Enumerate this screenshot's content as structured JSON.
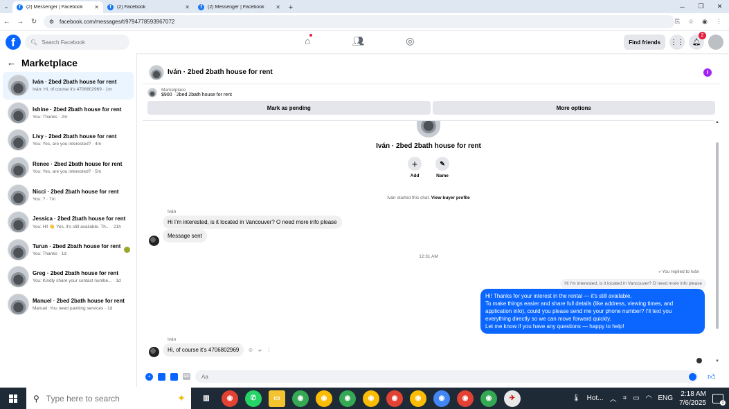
{
  "browser": {
    "tabs": [
      {
        "label": "(2) Messenger | Facebook",
        "active": true
      },
      {
        "label": "(2) Facebook",
        "active": false
      },
      {
        "label": "(2) Messenger | Facebook",
        "active": false
      }
    ],
    "url": "facebook.com/messages/t/9794778593967072"
  },
  "fb_header": {
    "search_placeholder": "Search Facebook",
    "find_friends": "Find friends",
    "notifications_count": "2"
  },
  "sidebar": {
    "title": "Marketplace",
    "conversations": [
      {
        "title": "Iván · 2bed 2bath house for rent",
        "preview": "Iván: Hi, of course it's 4706802969 · 1m",
        "active": true
      },
      {
        "title": "Ishine · 2bed 2bath house for rent",
        "preview": "You: Thanks · 2m"
      },
      {
        "title": "Livy · 2bed 2bath house for rent",
        "preview": "You: Yes, are you interested? · 4m"
      },
      {
        "title": "Renee · 2bed 2bath house for rent",
        "preview": "You: Yes, are you interested? · 5m"
      },
      {
        "title": "Nicci · 2bed 2bath house for rent",
        "preview": "You: ? · 7m"
      },
      {
        "title": "Jessica · 2bed 2bath house for rent",
        "preview": "You: Hi! 👋 Yes, it's still available. Th... · 21h"
      },
      {
        "title": "Turun · 2bed 2bath house for rent",
        "preview": "You: Thanks · 1d"
      },
      {
        "title": "Greg · 2bed 2bath house for rent",
        "preview": "You: Kindly share your contact numbe... · 1d"
      },
      {
        "title": "Manuel · 2bed 2bath house for rent",
        "preview": "Manuel: You need painting services · 1d"
      }
    ]
  },
  "chat": {
    "title": "Iván · 2bed 2bath house for rent",
    "listing_label": "Marketplace",
    "listing_value": "$900 · 2bed 2bath house for rent",
    "mark_pending": "Mark as pending",
    "more_options": "More options",
    "profile_name": "Iván · 2bed 2bath house for rent",
    "add_label": "Add",
    "name_label": "Name",
    "started_text": "Iván started this chat.",
    "view_buyer": "View buyer profile",
    "sender_1": "Iván",
    "msg_1": "Hi I'm interested, is it located in Vancouver? O need more info please",
    "msg_2": "Message sent",
    "timestamp": "12:31 AM",
    "replied_label": "You replied to Iván",
    "quoted": "Hi I'm interested, is it located in Vancouver? O need more info please",
    "reply_lines": [
      "Hi! Thanks for your interest in the rental — it's still available.",
      "To make things easier and share full details (like address, viewing times, and",
      "application info), could you please send me your phone number? I'll text you",
      "everything directly so we can move forward quickly.",
      "Let me know if you have any questions — happy to help!"
    ],
    "sender_2": "Iván",
    "msg_3": "Hi, of course it's 4706802969",
    "composer_placeholder": "Aa"
  },
  "taskbar": {
    "search_placeholder": "Type here to search",
    "weather": "Hot...",
    "lang": "ENG",
    "time": "2:18 AM",
    "date": "7/6/2025",
    "notif_count": "1"
  },
  "colors": {
    "fb_blue": "#0866ff",
    "active_conv": "#ebf5ff",
    "badge_red": "#e41e3f",
    "info_purple": "#a323f5",
    "taskbar": "#1f2a37"
  }
}
